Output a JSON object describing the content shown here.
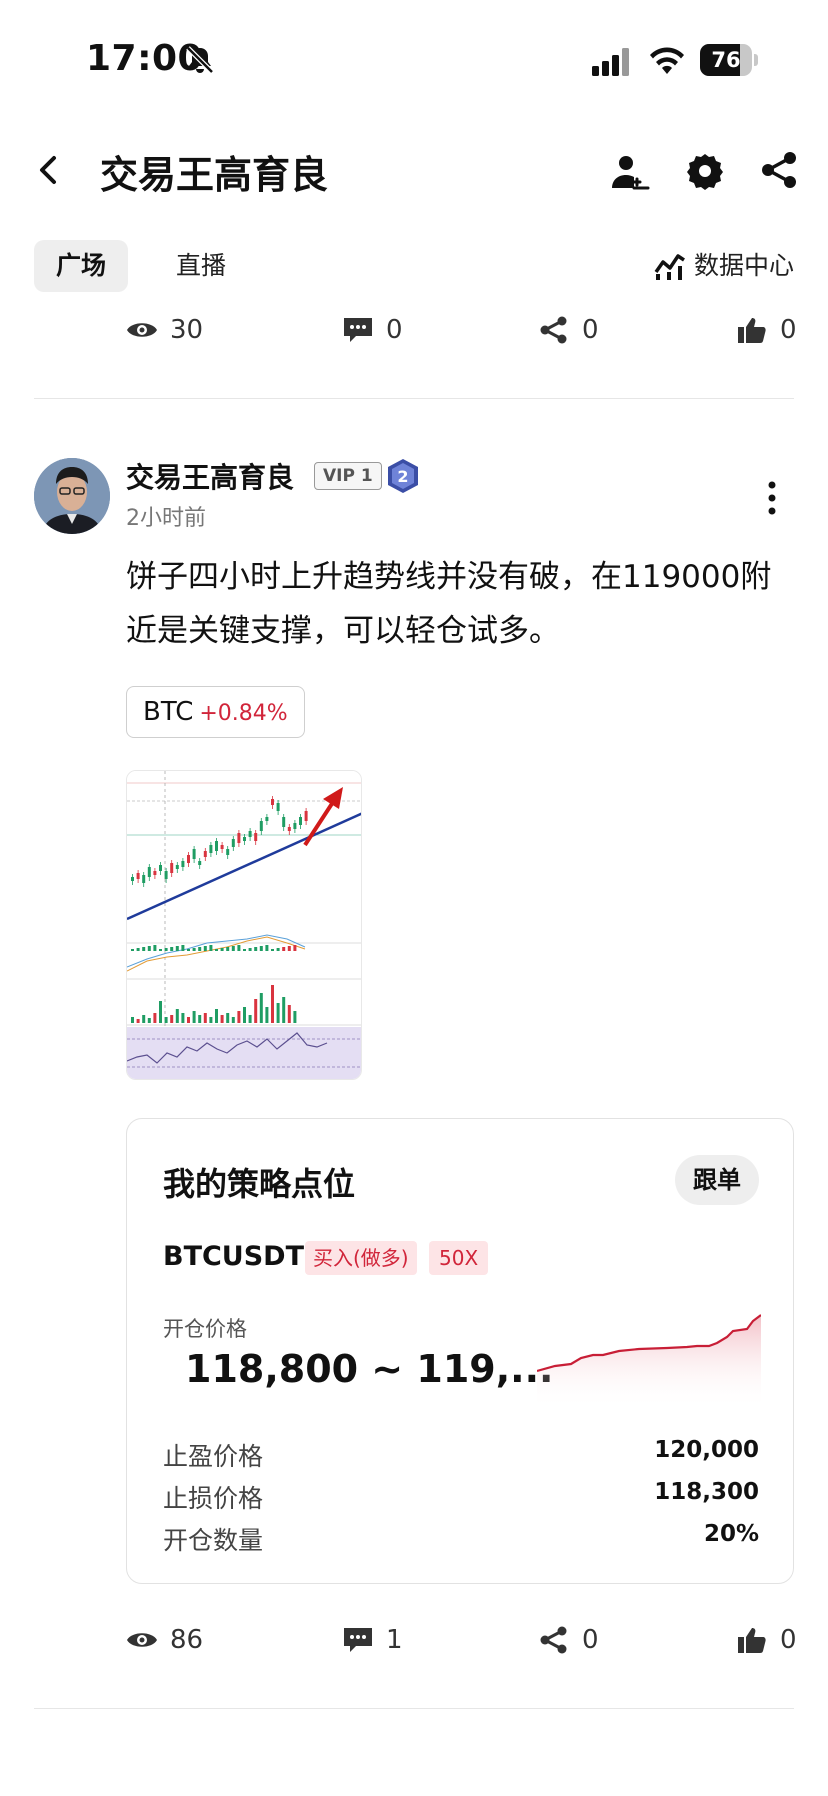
{
  "status_bar": {
    "time": "17:00",
    "battery": "76",
    "battery_level": 0.76
  },
  "header": {
    "title": "交易王高育良"
  },
  "tabs": [
    {
      "label": "广场"
    },
    {
      "label": "直播"
    }
  ],
  "data_center": {
    "label": "数据中心"
  },
  "prev_post_stats": {
    "views": "30",
    "comments": "0",
    "shares": "0",
    "likes": "0"
  },
  "post": {
    "author": "交易王高育良",
    "vip": "VIP 1",
    "level": "2",
    "time": "2小时前",
    "content": "饼子四小时上升趋势线并没有破，在119000附近是关键支撑，可以轻仓试多。",
    "coin": {
      "symbol": "BTC",
      "change": "+0.84%"
    },
    "strategy": {
      "title": "我的策略点位",
      "follow_label": "跟单",
      "pair": "BTCUSDT",
      "direction": "买入(做多)",
      "leverage": "50X",
      "open_price_label": "开仓价格",
      "open_price": "118,800 ~ 119,...",
      "take_profit_label": "止盈价格",
      "take_profit": "120,000",
      "stop_loss_label": "止损价格",
      "stop_loss": "118,300",
      "position_size_label": "开仓数量",
      "position_size": "20%"
    },
    "stats": {
      "views": "86",
      "comments": "1",
      "shares": "0",
      "likes": "0"
    }
  },
  "colors": {
    "accent_red": "#d1253a",
    "tag_bg": "#fde4e6",
    "trend_line": "#1f3b9b"
  }
}
